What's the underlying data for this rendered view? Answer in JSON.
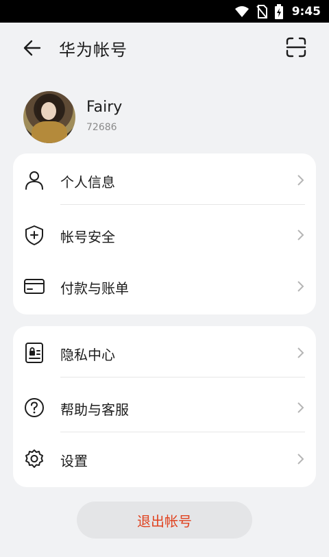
{
  "status_bar": {
    "time": "9:45"
  },
  "header": {
    "title": "华为帐号"
  },
  "profile": {
    "name": "Fairy",
    "id": "72686"
  },
  "group1": [
    {
      "label": "个人信息",
      "icon": "person-icon"
    },
    {
      "label": "帐号安全",
      "icon": "shield-icon"
    },
    {
      "label": "付款与账单",
      "icon": "card-icon"
    }
  ],
  "group2": [
    {
      "label": "隐私中心",
      "icon": "privacy-icon"
    },
    {
      "label": "帮助与客服",
      "icon": "help-icon"
    },
    {
      "label": "设置",
      "icon": "gear-icon"
    }
  ],
  "logout_label": "退出帐号",
  "colors": {
    "accent_red": "#e0421f",
    "background": "#f1f2f4"
  }
}
